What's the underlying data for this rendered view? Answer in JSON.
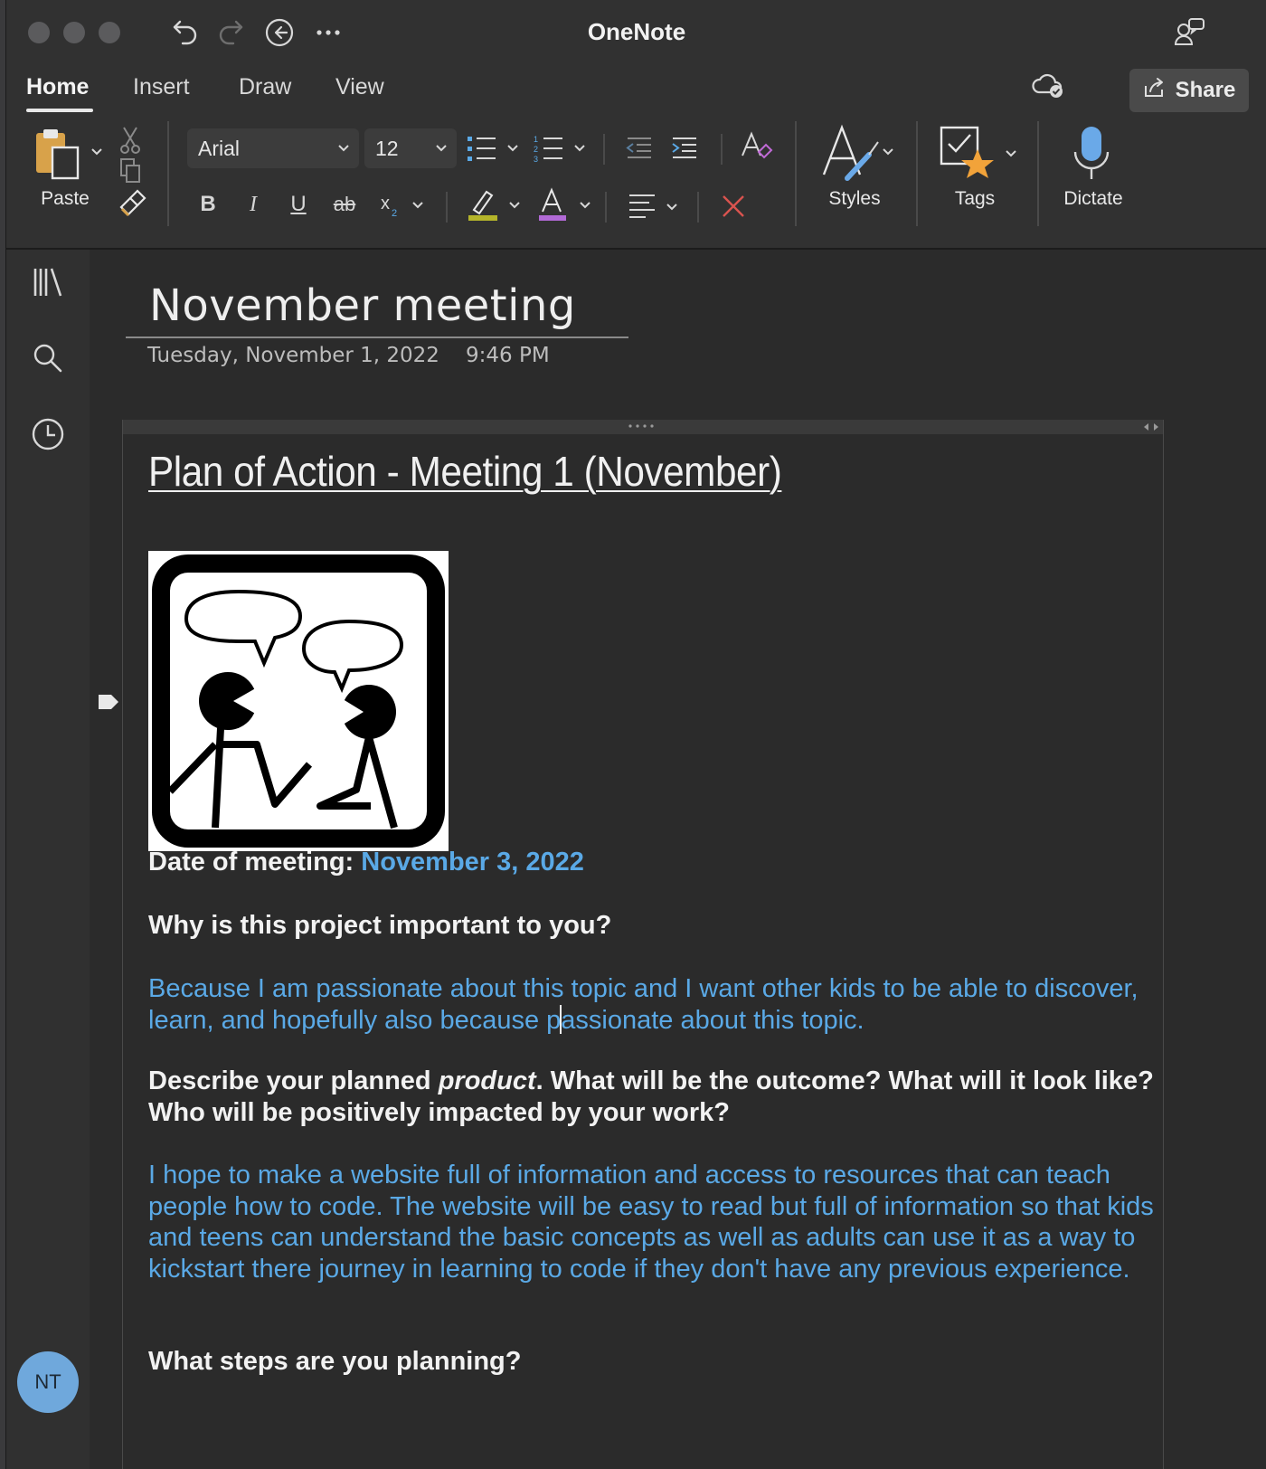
{
  "app": {
    "title": "OneNote"
  },
  "tabs": [
    {
      "label": "Home",
      "active": true
    },
    {
      "label": "Insert",
      "active": false
    },
    {
      "label": "Draw",
      "active": false
    },
    {
      "label": "View",
      "active": false
    }
  ],
  "share": {
    "label": "Share"
  },
  "ribbon": {
    "paste_label": "Paste",
    "font_name": "Arial",
    "font_size": "12",
    "styles_label": "Styles",
    "tags_label": "Tags",
    "dictate_label": "Dictate",
    "highlight_color": "#b5b52a",
    "font_color": "#b26ad6",
    "clear_color": "#d9534f",
    "dictate_color": "#6aa9e8",
    "tag_star_color": "#f2a33a"
  },
  "user": {
    "initials": "NT"
  },
  "page": {
    "title": "November meeting",
    "date": "Tuesday, November 1, 2022",
    "time": "9:46 PM"
  },
  "note": {
    "heading": "Plan of Action - Meeting 1 (November)",
    "date_label": "Date of meeting: ",
    "date_value": "November 3, 2022",
    "q1": "Why is this project important to you?",
    "a1_before_caret": "Because I am passionate about this topic and I want other kids to be able to discover, learn, and hopefully also because p",
    "a1_after_caret": "assionate about this topic.",
    "q2_part1": "Describe your planned ",
    "q2_italic": "product",
    "q2_part2": ". What will be the outcome? What will it look like? Who will be positively impacted by your work?",
    "a2": "I hope to make a website full of information and access to resources that can teach people how to code. The website will be easy to read but full of information so that kids and teens can understand the basic concepts as well as adults can use it as a way to kickstart there journey in learning to code if they don't have any previous experience.",
    "q3": "What steps are you planning?"
  }
}
